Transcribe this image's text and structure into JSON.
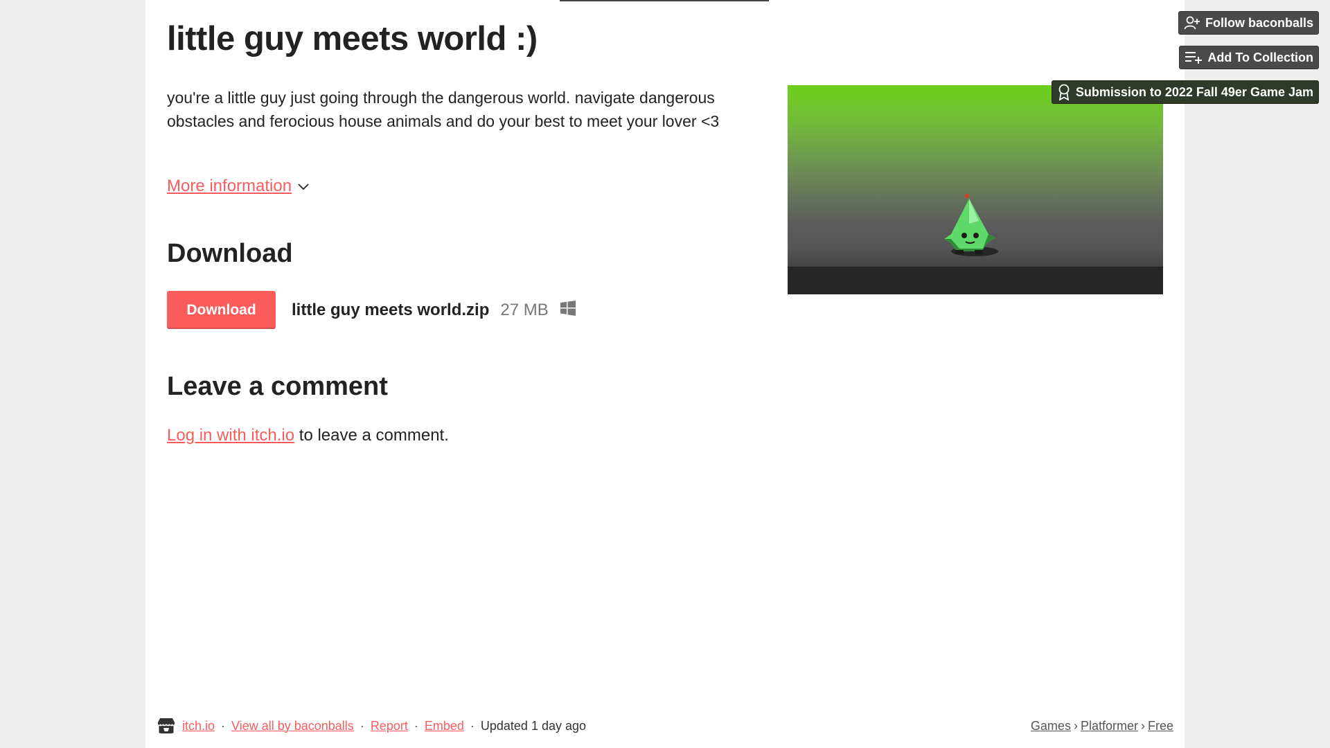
{
  "game": {
    "title": "little guy meets world :)",
    "description": "you're a little guy just going through the dangerous world. navigate dangerous obstacles and ferocious house animals and do your best to meet your lover <3",
    "more_info_label": "More information"
  },
  "download": {
    "heading": "Download",
    "button_label": "Download",
    "file_name": "little guy meets world.zip",
    "file_size": "27 MB",
    "platform_icon": "windows-icon"
  },
  "comments": {
    "heading": "Leave a comment",
    "login_link": "Log in with itch.io",
    "login_suffix": "to leave a comment."
  },
  "sidebar_buttons": {
    "follow": "Follow baconballs",
    "collection": "Add To Collection",
    "jam": "Submission to 2022 Fall 49er Game Jam"
  },
  "footer": {
    "site": "itch.io",
    "view_all": "View all by baconballs",
    "report": "Report",
    "embed": "Embed",
    "updated": "Updated 1 day ago",
    "breadcrumbs": [
      "Games",
      "Platformer",
      "Free"
    ]
  },
  "colors": {
    "accent": "#fa5c5c",
    "button_dark": "#4a4a4a",
    "jam_button": "#2f3a28",
    "page_bg": "#ffffff",
    "outer_bg": "#eeeeee"
  }
}
